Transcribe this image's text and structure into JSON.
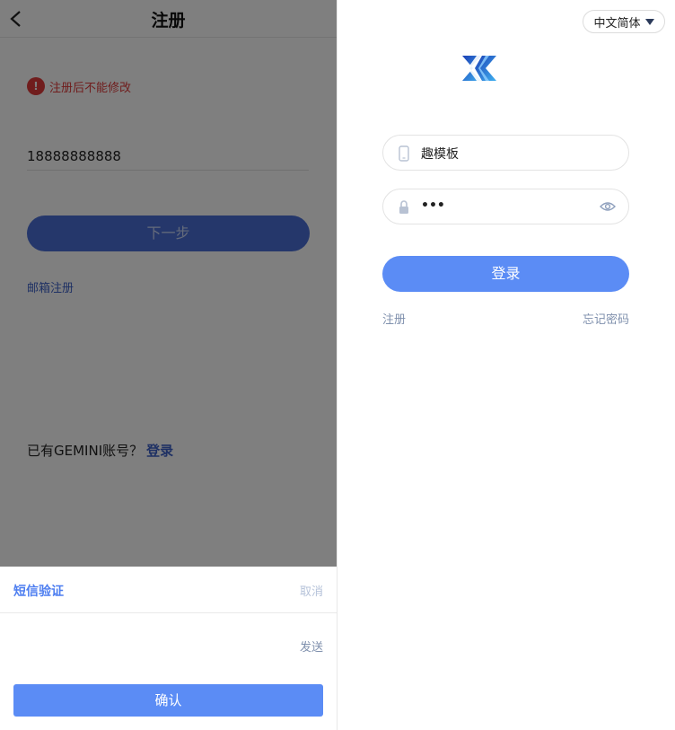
{
  "left": {
    "title": "注册",
    "warning": "注册后不能修改",
    "phone_value": "18888888888",
    "next_label": "下一步",
    "email_register": "邮箱注册",
    "have_account": "已有GEMINI账号？",
    "login_link": "登录",
    "sheet": {
      "title": "短信验证",
      "cancel": "取消",
      "send": "发送",
      "confirm": "确认"
    }
  },
  "right": {
    "language": "中文简体",
    "username_value": "趣模板",
    "password_value": "•••",
    "login_label": "登录",
    "register_link": "注册",
    "forgot_link": "忘记密码"
  },
  "colors": {
    "primary": "#5b8cf5",
    "link": "#3f63c9",
    "warning": "#e03b3b",
    "muted": "#7f90ad"
  }
}
